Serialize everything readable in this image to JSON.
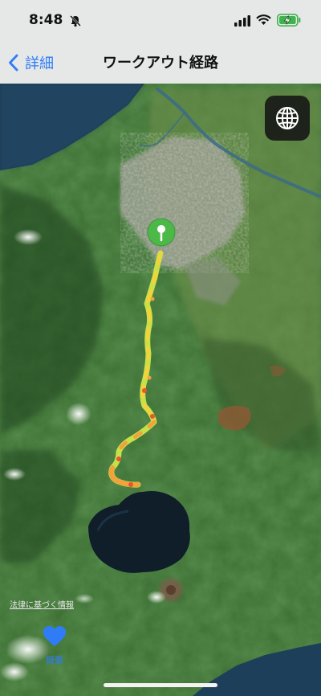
{
  "status_bar": {
    "time": "8:48"
  },
  "nav": {
    "back_label": "詳細",
    "title": "ワークアウト経路"
  },
  "map": {
    "legal_text": "法律に基づく情報",
    "summary_label": "概要",
    "route_colors": [
      "#f5d23a",
      "#f1a23b",
      "#e6552e",
      "#c6e04a"
    ],
    "pin_color": "#4cb848"
  }
}
